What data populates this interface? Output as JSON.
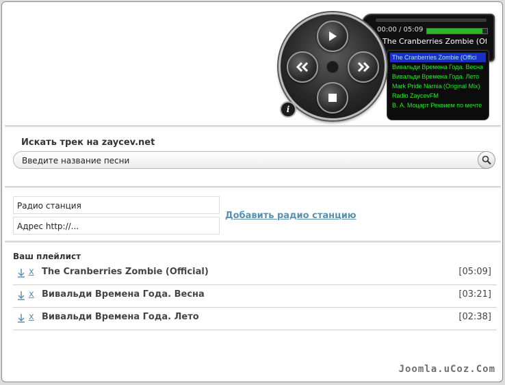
{
  "player": {
    "time": "00:00 / 05:09",
    "progress": 0.92,
    "current_song": "The Cranberries Zombie (Official",
    "playlist": [
      "The Cranberries Zombie (Offici",
      "Вивальди Времена Года. Весна",
      "Вивальди Времена Года. Лето",
      "Mark Pride Narnia (Original Mix)",
      "Radio ZaycevFM",
      "В. А. Моцарт Реквием по мечте"
    ],
    "info_label": "i"
  },
  "search": {
    "title": "Искать трек на zaycev.net",
    "value": "Введите название песни"
  },
  "radio": {
    "station_value": "Радио станция",
    "address_value": "Адрес http://...",
    "add_link": "Добавить радио станцию"
  },
  "playlist": {
    "title": "Ваш плейлист",
    "remove_label": "x",
    "tracks": [
      {
        "name": "The Cranberries Zombie (Official)",
        "duration": "[05:09]"
      },
      {
        "name": "Вивальди Времена Года. Весна",
        "duration": "[03:21]"
      },
      {
        "name": "Вивальди Времена Года. Лето",
        "duration": "[02:38]"
      }
    ]
  },
  "watermark": "Joomla.uCoz.Com",
  "colors": {
    "accent_link": "#5b8fae",
    "playlist_text": "#2ee52e",
    "playlist_highlight": "#1b2fc8",
    "progress_fill": "#2fb52f"
  }
}
